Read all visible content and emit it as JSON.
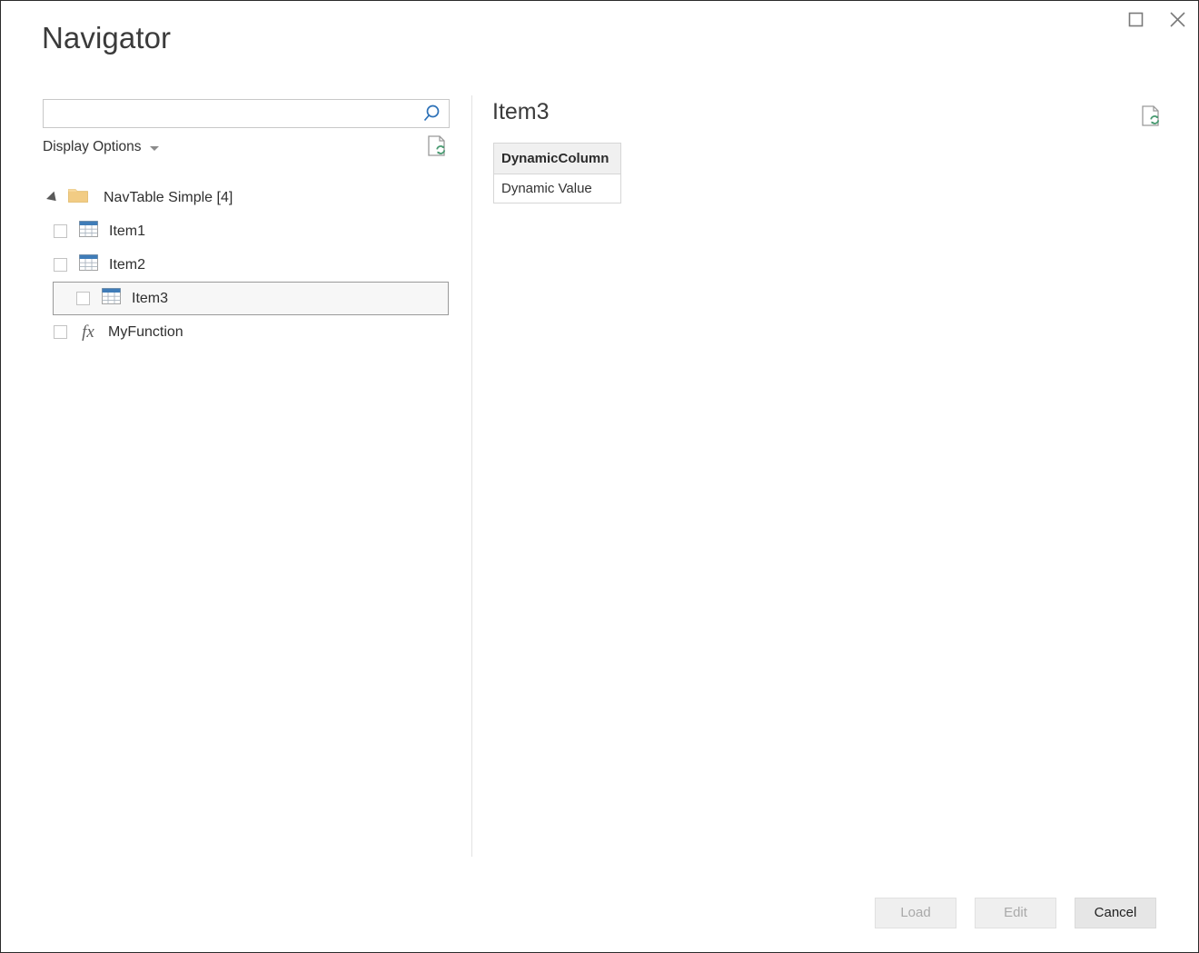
{
  "window": {
    "title": "Navigator",
    "controls": [
      {
        "name": "maximize",
        "icon": "maximize-icon"
      },
      {
        "name": "close",
        "icon": "close-icon"
      }
    ]
  },
  "search": {
    "value": "",
    "placeholder": "",
    "icon": "search-icon"
  },
  "display_options": {
    "label": "Display Options",
    "caret_icon": "chevron-down-icon"
  },
  "refresh": {
    "left_icon": "refresh-page-icon",
    "right_icon": "refresh-page-icon"
  },
  "tree": {
    "root": {
      "label": "NavTable Simple [4]",
      "icon": "folder-icon",
      "expanded": true,
      "expander_icon": "expander-triangle-icon"
    },
    "items": [
      {
        "label": "Item1",
        "icon": "table-icon",
        "checked": false,
        "selected": false
      },
      {
        "label": "Item2",
        "icon": "table-icon",
        "checked": false,
        "selected": false
      },
      {
        "label": "Item3",
        "icon": "table-icon",
        "checked": false,
        "selected": true
      },
      {
        "label": "MyFunction",
        "icon": "function-fx-icon",
        "checked": false,
        "selected": false
      }
    ]
  },
  "preview": {
    "title": "Item3",
    "table": {
      "columns": [
        "DynamicColumn"
      ],
      "rows": [
        [
          "Dynamic Value"
        ]
      ]
    }
  },
  "footer": {
    "buttons": [
      {
        "label": "Load",
        "enabled": false
      },
      {
        "label": "Edit",
        "enabled": false
      },
      {
        "label": "Cancel",
        "enabled": true
      }
    ]
  },
  "colors": {
    "accent_blue": "#3f7cb8",
    "folder_gold": "#f2cc84",
    "refresh_green": "#4a9b72",
    "selection_border": "#9a9a9a",
    "selection_fill": "#f7f7f7"
  }
}
